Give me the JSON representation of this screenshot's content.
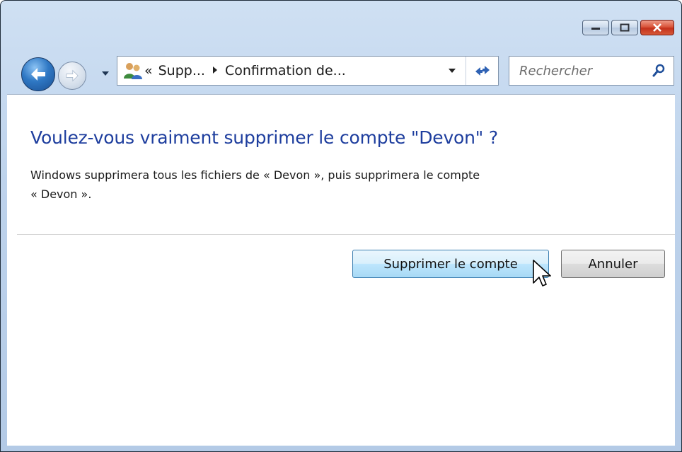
{
  "window": {
    "caption_buttons": {
      "minimize": "minimize-icon",
      "maximize": "maximize-icon",
      "close": "close-icon"
    }
  },
  "navigation": {
    "back_icon": "back-arrow-icon",
    "forward_icon": "forward-arrow-icon",
    "history_icon": "chevron-down-icon",
    "address": {
      "icon": "user-accounts-icon",
      "prefix": "«",
      "crumbs": [
        "Supp...",
        "Confirmation de..."
      ],
      "separator_icon": "breadcrumb-arrow-icon"
    },
    "refresh_icon": "refresh-icon",
    "search": {
      "placeholder": "Rechercher",
      "icon": "search-icon"
    }
  },
  "dialog": {
    "title": "Voulez-vous vraiment supprimer le compte \"Devon\" ?",
    "message_line1": "Windows supprimera tous les fichiers de « Devon », puis supprimera le compte",
    "message_line2": "« Devon ».",
    "primary_button": "Supprimer le compte",
    "cancel_button": "Annuler"
  },
  "colors": {
    "title_text": "#1e3e9e",
    "primary_button_border": "#3c7fb1",
    "close_button": "#c4321c"
  }
}
